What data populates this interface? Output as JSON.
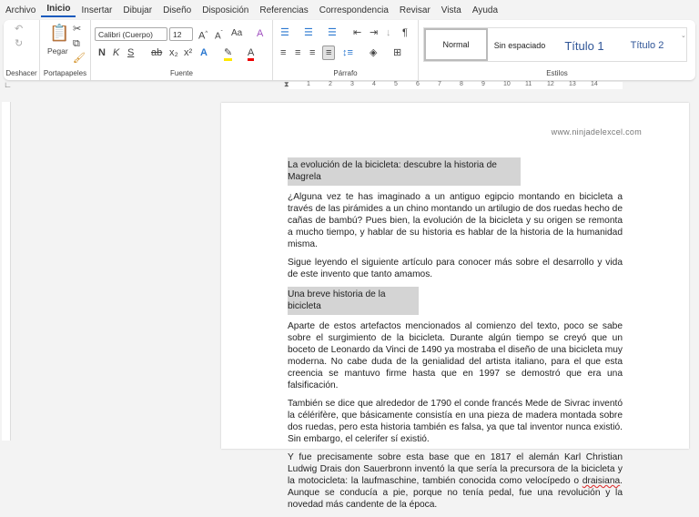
{
  "menu": [
    "Archivo",
    "Inicio",
    "Insertar",
    "Dibujar",
    "Diseño",
    "Disposición",
    "Referencias",
    "Correspondencia",
    "Revisar",
    "Vista",
    "Ayuda"
  ],
  "ribbon": {
    "undo_group": "Deshacer",
    "clipboard": {
      "label": "Portapapeles",
      "paste": "Pegar"
    },
    "font": {
      "label": "Fuente",
      "family": "Calibri (Cuerpo)",
      "size": "12",
      "bold": "N",
      "italic": "K",
      "underline": "S",
      "aa": "Aa"
    },
    "paragraph": {
      "label": "Párrafo"
    },
    "styles": {
      "label": "Estilos",
      "items": [
        "Normal",
        "Sin espaciado",
        "Título 1",
        "Título 2"
      ],
      "selected": "Normal"
    }
  },
  "ruler": {
    "ticks": [
      "1",
      "2",
      "3",
      "4",
      "5",
      "6",
      "7",
      "8",
      "9",
      "10",
      "11",
      "12",
      "13",
      "14"
    ]
  },
  "document": {
    "header_url": "www.ninjadelexcel.com",
    "title": "La evolución de la bicicleta: descubre la historia de Magrela",
    "p1": "¿Alguna vez te has imaginado a un antiguo egipcio montando en bicicleta a través de las pirámides a un chino montando un artilugio de dos ruedas hecho de cañas de bambú? Pues bien, la evolución de la bicicleta y su origen se remonta a mucho tiempo, y hablar de su historia es hablar de la historia de la humanidad misma.",
    "p2": "Sigue leyendo el siguiente artículo para conocer más sobre el desarrollo y vida de este invento que tanto amamos.",
    "heading2": "Una breve historia de la bicicleta",
    "p3": "Aparte de estos artefactos mencionados al comienzo del texto, poco se sabe sobre el surgimiento de la bicicleta. Durante algún tiempo se creyó que un boceto de Leonardo da Vinci de 1490 ya mostraba el diseño de una bicicleta muy moderna. No cabe duda de la genialidad del artista italiano, para el que esta creencia se mantuvo firme hasta que en 1997 se demostró que era una falsificación.",
    "p4": "También se dice que alrededor de 1790 el conde francés Mede de Sivrac inventó la célérifère, que básicamente consistía en una pieza de madera montada sobre dos ruedas, pero esta historia también es falsa, ya que tal inventor nunca existió. Sin embargo, el celerifer sí existió.",
    "p5a": "Y fue precisamente sobre esta base que en 1817 el alemán Karl Christian Ludwig Drais don Sauerbronn inventó la que sería la precursora de la bicicleta y la motocicleta: la laufmaschine, también conocida como velocípedo o ",
    "p5err": "draisiana",
    "p5b": ". Aunque se conducía a pie, porque no tenía pedal, fue una revolución y la novedad más candente de la época."
  },
  "colors": {
    "accent": "#185abd",
    "highlight": "#d4d4d4",
    "title_style": "#2f5597"
  }
}
